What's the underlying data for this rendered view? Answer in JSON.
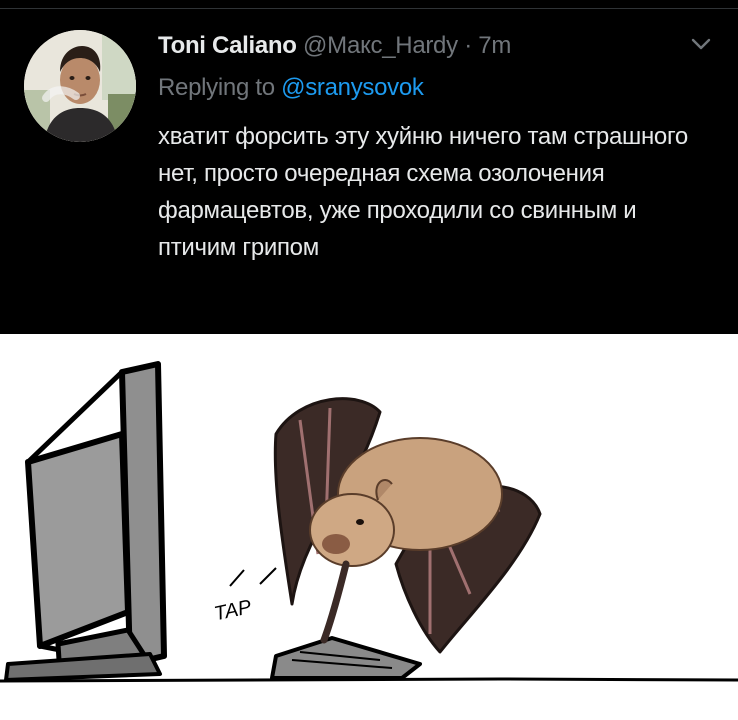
{
  "tweet": {
    "display_name": "Toni Caliano",
    "handle": "@Макс_Hardy",
    "separator": "·",
    "time": "7m",
    "reply_prefix": "Replying to",
    "reply_handle": "@sranysovok",
    "text": "хватит форсить эту хуйню ничего там страшного нет, просто очередная схема озолочения фармацевтов, уже проходили со свинным и птичим грипом",
    "icons": {
      "avatar": "user-avatar-photo",
      "more": "chevron-down-icon"
    },
    "colors": {
      "background": "#000000",
      "primary_text": "#e7e9ea",
      "secondary_text": "#71767b",
      "link": "#1d9bf0"
    }
  },
  "comic": {
    "sound_effect": "TAP",
    "colors": {
      "monitor": "#9b9b9b",
      "bat_fur": "#c9a27e",
      "bat_wing": "#3b2a26",
      "outline": "#000000"
    }
  }
}
